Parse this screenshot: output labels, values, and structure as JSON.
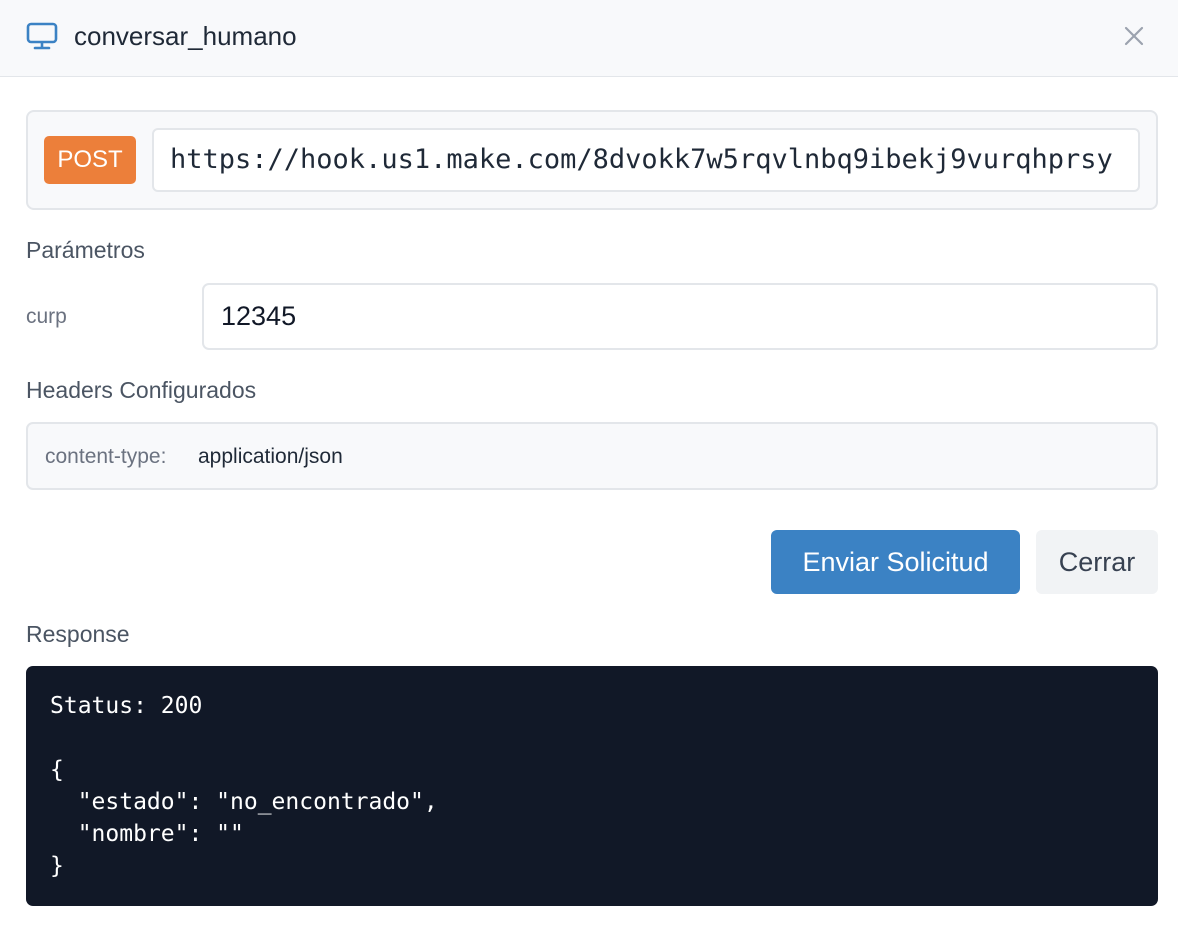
{
  "header": {
    "title": "conversar_humano",
    "icon": "monitor-icon",
    "close_icon": "close-icon",
    "accent_color": "#3b82c4"
  },
  "request": {
    "method": "POST",
    "method_color": "#ec7f3a",
    "url": "https://hook.us1.make.com/8dvokk7w5rqvlnbq9ibekj9vurqhprsy"
  },
  "parameters": {
    "title": "Parámetros",
    "items": [
      {
        "label": "curp",
        "value": "12345"
      }
    ]
  },
  "headers_section": {
    "title": "Headers Configurados",
    "items": [
      {
        "key": "content-type:",
        "value": "application/json"
      }
    ]
  },
  "actions": {
    "send_label": "Enviar Solicitud",
    "close_label": "Cerrar"
  },
  "response": {
    "title": "Response",
    "lines": [
      "Status: 200",
      "",
      "{",
      "  \"estado\": \"no_encontrado\",",
      "  \"nombre\": \"\"",
      "}"
    ]
  }
}
